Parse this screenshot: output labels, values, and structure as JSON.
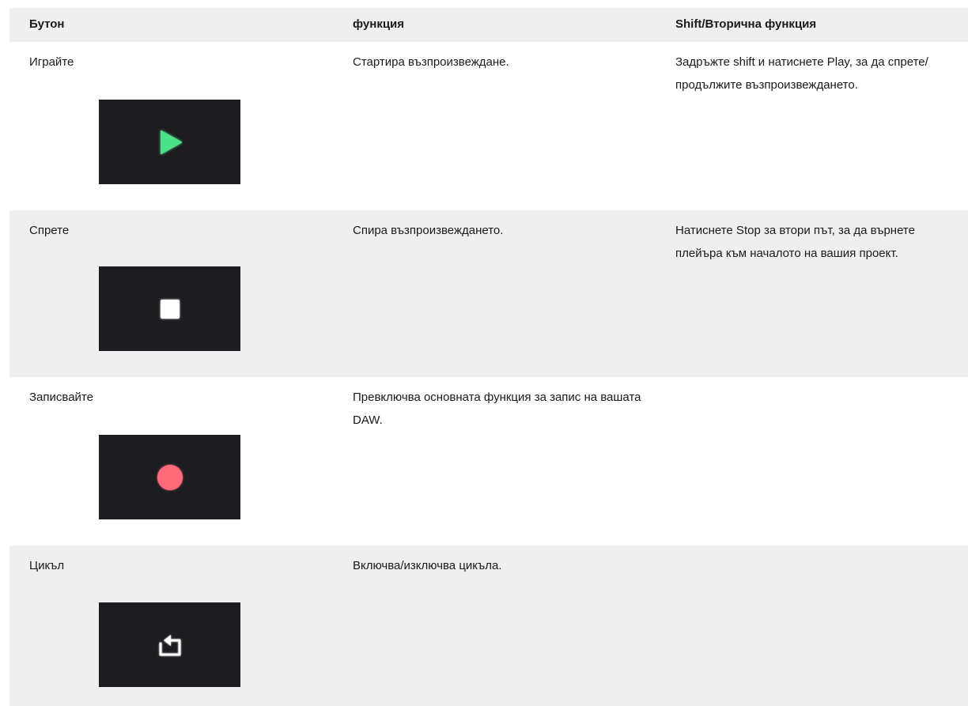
{
  "header": {
    "col_button": "Бутон",
    "col_function": "функция",
    "col_shift": "Shift/Вторична функция"
  },
  "rows": [
    {
      "button": "Играйте",
      "function": "Стартира възпроизвеждане.",
      "shift": "Задръжте shift и натиснете Play, за да спрете/продължите възпроизвеждането.",
      "icon": "play-icon",
      "icon_color": "#4ee08a"
    },
    {
      "button": "Спрете",
      "function": "Спира възпроизвеждането.",
      "shift": "Натиснете Stop за втори път, за да върнете плейъра към началото на вашия проект.",
      "icon": "stop-icon",
      "icon_color": "#ffffff"
    },
    {
      "button": "Записвайте",
      "function": "Превключва основната функция за запис на вашата DAW.",
      "shift": "",
      "icon": "record-icon",
      "icon_color": "#ff6b7a"
    },
    {
      "button": "Цикъл",
      "function": "Включва/изключва цикъла.",
      "shift": "",
      "icon": "loop-icon",
      "icon_color": "#ffffff"
    }
  ]
}
